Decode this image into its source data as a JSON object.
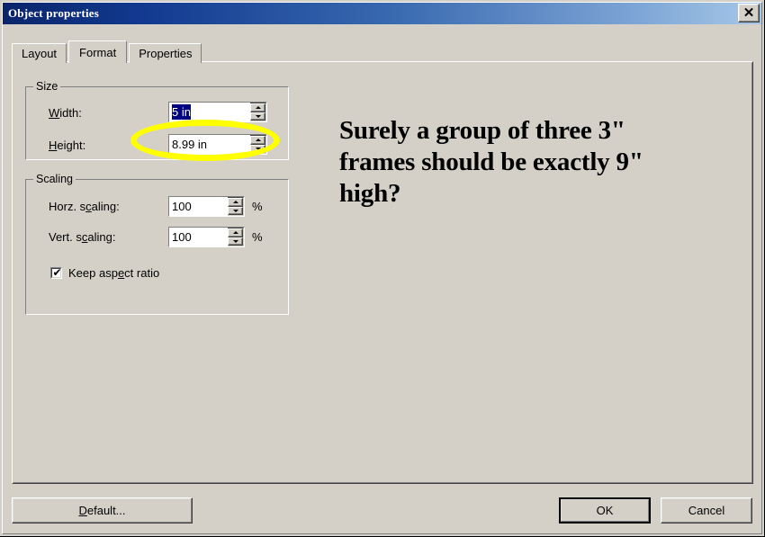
{
  "window": {
    "title": "Object properties",
    "close_icon": "close-icon",
    "close_glyph": "✕"
  },
  "tabs": [
    {
      "label": "Layout",
      "active": false
    },
    {
      "label": "Format",
      "active": true
    },
    {
      "label": "Properties",
      "active": false
    }
  ],
  "size_group": {
    "legend": "Size",
    "width": {
      "label_pre": "",
      "label_accel": "W",
      "label_post": "idth:",
      "value": "5 in",
      "selected": true
    },
    "height": {
      "label_pre": "",
      "label_accel": "H",
      "label_post": "eight:",
      "value": "8.99 in",
      "selected": false
    }
  },
  "scaling_group": {
    "legend": "Scaling",
    "horz": {
      "label_pre": "Horz. s",
      "label_accel": "c",
      "label_post": "aling:",
      "value": "100",
      "unit": "%"
    },
    "vert": {
      "label_pre": "Vert. s",
      "label_accel": "c",
      "label_post": "aling:",
      "value": "100",
      "unit": "%"
    },
    "keep_aspect": {
      "label_pre": "Keep asp",
      "label_accel": "e",
      "label_post": "ct ratio",
      "checked": true,
      "tick_glyph": "✔"
    }
  },
  "annotation": {
    "text": "Surely a group of three 3\" frames should be exactly 9\" high?",
    "highlight_color": "#ffff00",
    "highlight_target": "height-field"
  },
  "buttons": {
    "default": {
      "label_pre": "",
      "label_accel": "D",
      "label_post": "efault..."
    },
    "ok": {
      "label": "OK",
      "is_default": true
    },
    "cancel": {
      "label": "Cancel",
      "is_default": false
    }
  },
  "colors": {
    "dialog_background": "#d4d0c8",
    "titlebar_start": "#0a246a",
    "titlebar_end": "#a6c8e8",
    "selection": "#000080",
    "highlight": "#ffff00"
  }
}
